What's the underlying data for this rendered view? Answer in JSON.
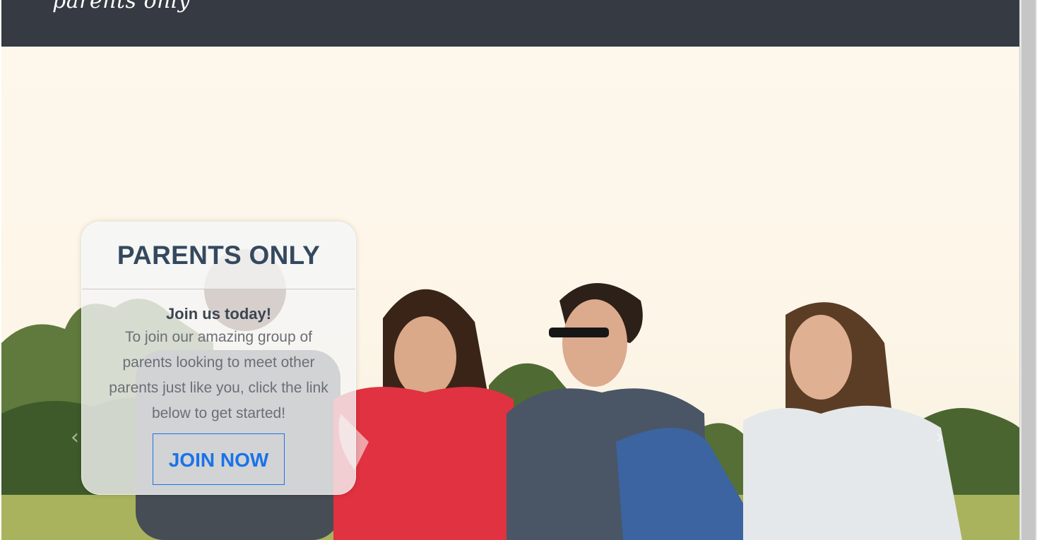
{
  "navbar": {
    "logo_text": "parents only"
  },
  "hero": {
    "prev_icon": "chevron-left-icon",
    "next_icon": "chevron-right-icon"
  },
  "caption": {
    "title": "PARENTS ONLY",
    "subtitle": "Join us today!",
    "text": "To join our amazing group of parents looking to meet other parents just like you, click the link below to get started!",
    "button_label": "JOIN NOW"
  },
  "colors": {
    "navbar": "#353a43",
    "title": "#34495e",
    "button": "#1a73e8"
  }
}
